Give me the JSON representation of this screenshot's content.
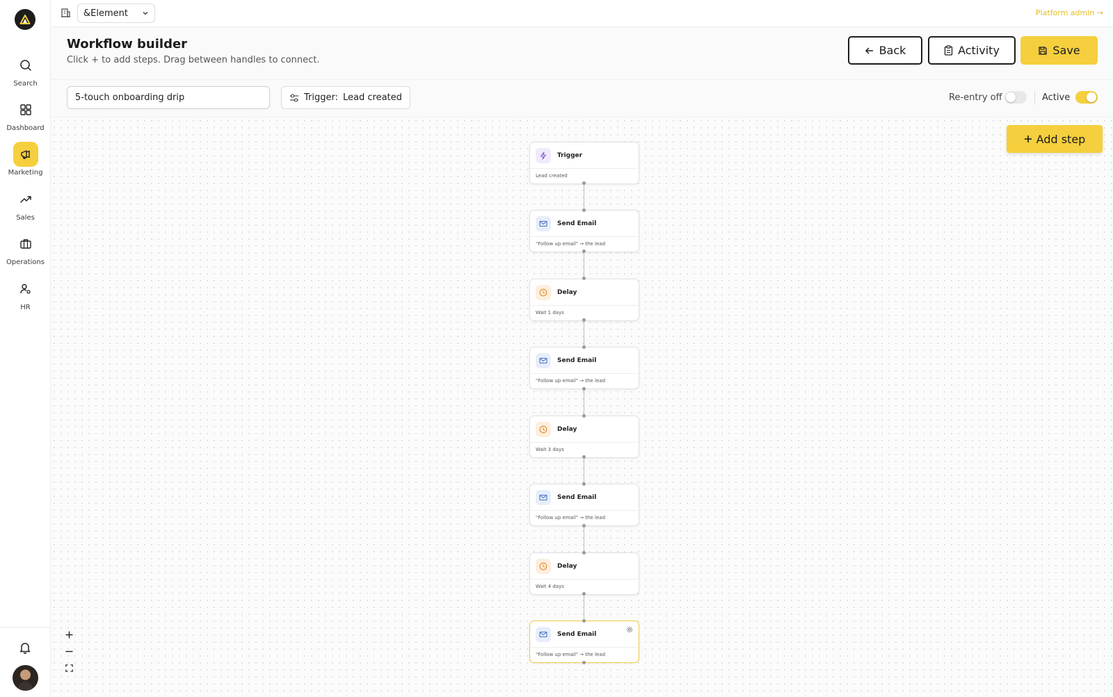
{
  "sidebar": {
    "items": [
      {
        "label": "Search",
        "icon": "search-icon"
      },
      {
        "label": "Dashboard",
        "icon": "dashboard-icon"
      },
      {
        "label": "Marketing",
        "icon": "megaphone-icon",
        "active": true
      },
      {
        "label": "Sales",
        "icon": "trending-up-icon"
      },
      {
        "label": "Operations",
        "icon": "briefcase-icon"
      },
      {
        "label": "HR",
        "icon": "users-gear-icon"
      }
    ]
  },
  "topbar": {
    "org_name": "&Element",
    "platform_admin": "Platform admin →"
  },
  "header": {
    "title": "Workflow builder",
    "subtitle": "Click + to add steps. Drag between handles to connect.",
    "back_label": "Back",
    "activity_label": "Activity",
    "save_label": "Save"
  },
  "toolbar": {
    "workflow_name": "5-touch onboarding drip",
    "trigger_prefix": "Trigger:",
    "trigger_value": "Lead created",
    "reentry_label": "Re-entry off",
    "reentry_on": false,
    "active_label": "Active",
    "active_on": true
  },
  "canvas": {
    "add_step_label": "Add step",
    "nodes": [
      {
        "type": "trigger",
        "title": "Trigger",
        "detail": "Lead created"
      },
      {
        "type": "email",
        "title": "Send Email",
        "detail": "\"Follow up email\" → the lead"
      },
      {
        "type": "delay",
        "title": "Delay",
        "detail": "Wait 1 days"
      },
      {
        "type": "email",
        "title": "Send Email",
        "detail": "\"Follow up email\" → the lead"
      },
      {
        "type": "delay",
        "title": "Delay",
        "detail": "Wait 3 days"
      },
      {
        "type": "email",
        "title": "Send Email",
        "detail": "\"Follow up email\" → the lead"
      },
      {
        "type": "delay",
        "title": "Delay",
        "detail": "Wait 4 days"
      },
      {
        "type": "email",
        "title": "Send Email",
        "detail": "\"Follow up email\" → the lead",
        "selected": true
      }
    ]
  },
  "colors": {
    "accent": "#f5cf3d",
    "admin_link": "#e7bd25"
  }
}
